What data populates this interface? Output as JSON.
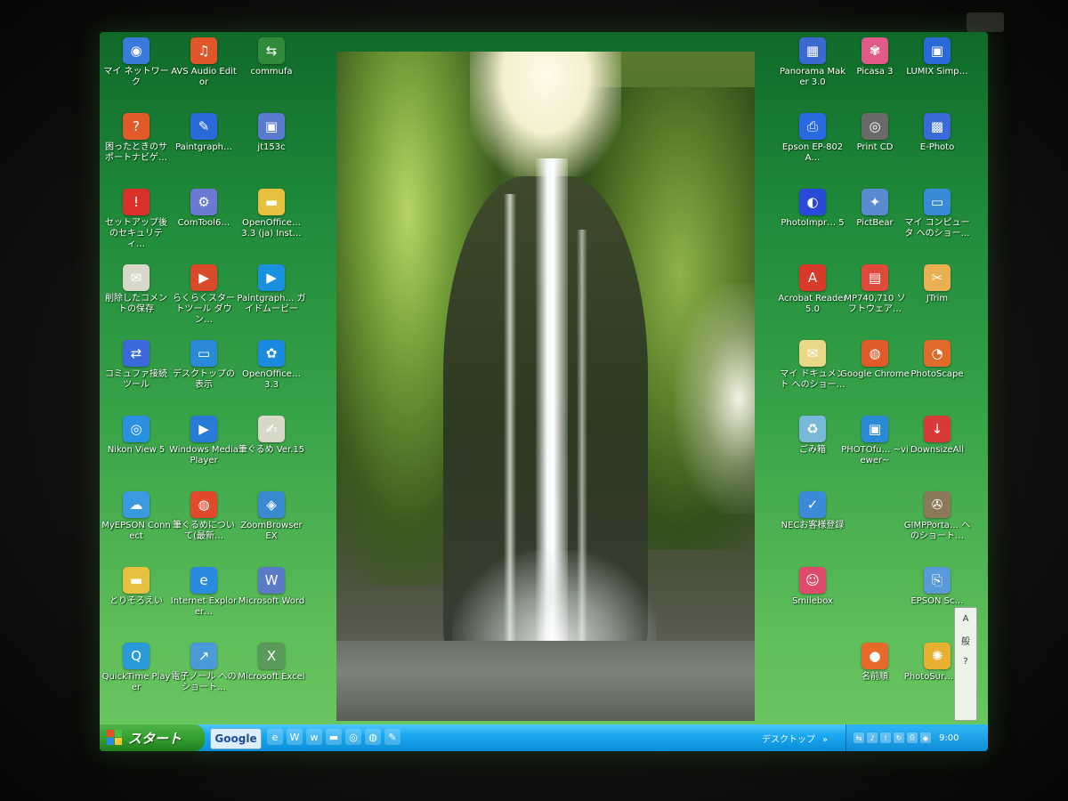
{
  "desktop": {
    "icons_left": [
      {
        "label": "マイ ネットワーク",
        "icon": "network-icon",
        "color": "#3a7ad8"
      },
      {
        "label": "AVS Audio Editor",
        "icon": "audio-editor-icon",
        "color": "#e0562a"
      },
      {
        "label": "commufa",
        "icon": "commufa-icon",
        "color": "#2f8a3a"
      },
      {
        "label": "困ったときのサポートナビゲ…",
        "icon": "support-navi-icon",
        "color": "#e05a2a"
      },
      {
        "label": "Paintgraph…",
        "icon": "paintgraph-icon",
        "color": "#2a6ad8"
      },
      {
        "label": "jt153c",
        "icon": "jt153c-icon",
        "color": "#5a7ad0"
      },
      {
        "label": "セットアップ後のセキュリティ…",
        "icon": "security-setup-icon",
        "color": "#d8302a"
      },
      {
        "label": "ComTool6…",
        "icon": "comtool-icon",
        "color": "#6a7ad0"
      },
      {
        "label": "OpenOffice… 3.3 (ja) Inst…",
        "icon": "folder-icon",
        "color": "#e8c040"
      },
      {
        "label": "削除したコメントの保存",
        "icon": "document-icon",
        "color": "#d8d8c8"
      },
      {
        "label": "らくらくスタートツール ダウン…",
        "icon": "start-tool-icon",
        "color": "#d84a2a"
      },
      {
        "label": "Paintgraph… ガイドムービー",
        "icon": "guide-movie-icon",
        "color": "#1a90e0"
      },
      {
        "label": "コミュファ接続ツール",
        "icon": "connect-tool-icon",
        "color": "#3a6ad8"
      },
      {
        "label": "デスクトップの表示",
        "icon": "show-desktop-icon",
        "color": "#2a8ad8"
      },
      {
        "label": "OpenOffice… 3.3",
        "icon": "openoffice-icon",
        "color": "#1a8ae0"
      },
      {
        "label": "Nikon View 5",
        "icon": "nikon-view-icon",
        "color": "#2a90e0"
      },
      {
        "label": "Windows Media Player",
        "icon": "media-player-icon",
        "color": "#2a7ad8"
      },
      {
        "label": "筆ぐるめ Ver.15",
        "icon": "fudegurume-icon",
        "color": "#d8d8c8"
      },
      {
        "label": "MyEPSON Connect",
        "icon": "myepson-icon",
        "color": "#3a9ae0"
      },
      {
        "label": "筆ぐるめについて(最新…",
        "icon": "chrome-icon",
        "color": "#e04a2a"
      },
      {
        "label": "ZoomBrowser EX",
        "icon": "zoombrowser-icon",
        "color": "#3a8ad0"
      },
      {
        "label": "とりそろえい",
        "icon": "folder-icon",
        "color": "#e8c040"
      },
      {
        "label": "Internet Explorer…",
        "icon": "internet-explorer-icon",
        "color": "#2a8ae0"
      },
      {
        "label": "Microsoft Word",
        "icon": "word-icon",
        "color": "#5a7ac8"
      },
      {
        "label": "QuickTime Player",
        "icon": "quicktime-icon",
        "color": "#2a9ad8"
      },
      {
        "label": "電子ノール へのショート…",
        "icon": "shortcut-icon",
        "color": "#4a9ad8"
      },
      {
        "label": "Microsoft Excel",
        "icon": "excel-icon",
        "color": "#5a9a5a"
      }
    ],
    "icons_right": [
      {
        "label": "Panorama Maker 3.0",
        "icon": "panorama-icon",
        "color": "#3a6ad0"
      },
      {
        "label": "Picasa 3",
        "icon": "picasa-icon",
        "color": "#e05a8a"
      },
      {
        "label": "LUMIX Simp…",
        "icon": "lumix-icon",
        "color": "#2a6ad8"
      },
      {
        "label": "Epson EP-802A…",
        "icon": "epson-printer-icon",
        "color": "#2a6ae0"
      },
      {
        "label": "Print CD",
        "icon": "print-cd-icon",
        "color": "#6a6a6a"
      },
      {
        "label": "E-Photo",
        "icon": "e-photo-icon",
        "color": "#3a6ad8"
      },
      {
        "label": "PhotoImpr… 5",
        "icon": "photoimpression-icon",
        "color": "#2a4ad8"
      },
      {
        "label": "PictBear",
        "icon": "pictbear-icon",
        "color": "#5a8ad0"
      },
      {
        "label": "マイ コンピュータ へのショー…",
        "icon": "my-computer-icon",
        "color": "#3a8ad8"
      },
      {
        "label": "Acrobat Reader 5.0",
        "icon": "acrobat-icon",
        "color": "#d83a2a"
      },
      {
        "label": "MP740,710 ソフトウェア…",
        "icon": "mp-software-icon",
        "color": "#e04a3a"
      },
      {
        "label": "JTrim",
        "icon": "jtrim-icon",
        "color": "#e8b050"
      },
      {
        "label": "マイ ドキュメント へのショー…",
        "icon": "my-documents-icon",
        "color": "#e8d888"
      },
      {
        "label": "Google Chrome",
        "icon": "google-chrome-icon",
        "color": "#e05a2a"
      },
      {
        "label": "PhotoScape",
        "icon": "photoscape-icon",
        "color": "#e06a2a"
      },
      {
        "label": "ごみ箱",
        "icon": "recycle-bin-icon",
        "color": "#7ab8d8"
      },
      {
        "label": "PHOTOfu… ~viewer~",
        "icon": "photofunstudio-icon",
        "color": "#2a8ad8"
      },
      {
        "label": "DownsizeAll",
        "icon": "downsizeall-icon",
        "color": "#d83a3a"
      },
      {
        "label": "NECお客様登録",
        "icon": "nec-registration-icon",
        "color": "#3a8ad8"
      },
      {
        "label": "",
        "icon": "",
        "color": ""
      },
      {
        "label": "GIMPPorta… へのショート…",
        "icon": "gimp-portable-icon",
        "color": "#8a7a5a"
      },
      {
        "label": "Smilebox",
        "icon": "smilebox-icon",
        "color": "#e04a6a"
      },
      {
        "label": "",
        "icon": "",
        "color": ""
      },
      {
        "label": "EPSON Sc…",
        "icon": "epson-scan-icon",
        "color": "#5a9ad8"
      },
      {
        "label": "",
        "icon": "",
        "color": ""
      },
      {
        "label": "名前順",
        "icon": "sort-icon",
        "color": "#e86a2a"
      },
      {
        "label": "PhotoSur… 4.5",
        "icon": "photosurfer-icon",
        "color": "#e8b030"
      }
    ]
  },
  "taskbar": {
    "start_label": "スタート",
    "google_label": "Google",
    "desktop_label": "デスクトップ",
    "clock": "9:00",
    "quick_launch": [
      "ie-icon",
      "word-icon",
      "w-icon",
      "folder-icon",
      "cd-icon",
      "chrome-icon",
      "paint-icon"
    ],
    "tray_icons": [
      "network-tray-icon",
      "volume-icon",
      "security-icon",
      "update-icon",
      "printer-tray-icon",
      "shield-tray-icon"
    ]
  },
  "language_bar": {
    "items": [
      "A",
      "般",
      "?"
    ]
  }
}
